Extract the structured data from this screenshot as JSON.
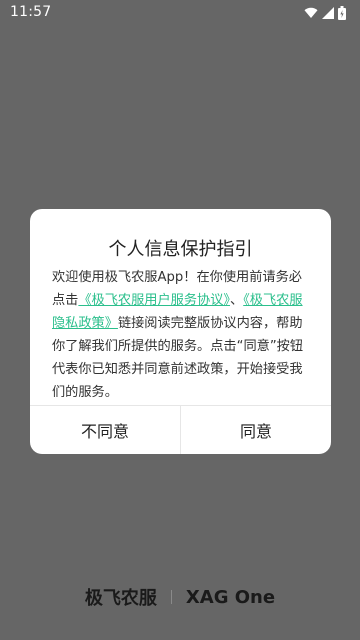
{
  "status_bar": {
    "time": "11:57",
    "icons": [
      "wifi-icon",
      "cellular-signal-icon",
      "battery-icon"
    ]
  },
  "dialog": {
    "title": "个人信息保护指引",
    "body": {
      "intro": "欢迎使用极飞农服App！在你使用前请务必点击",
      "link_user_agreement": "《极飞农服用户服务协议》",
      "separator": "、",
      "link_privacy_policy": "《极飞农服隐私政策》",
      "middle": "链接阅读完整版协议内容，帮助你了解我们所提供的服务。点击“同意”按钮代表你已知悉并同意前述政策，开始接受我们的服务。"
    },
    "disagree_label": "不同意",
    "agree_label": "同意"
  },
  "footer": {
    "brand_cn": "极飞农服",
    "brand_en": "XAG One"
  },
  "colors": {
    "overlay": "#666666",
    "link": "#2bbf8c",
    "dialog_bg": "#ffffff"
  }
}
